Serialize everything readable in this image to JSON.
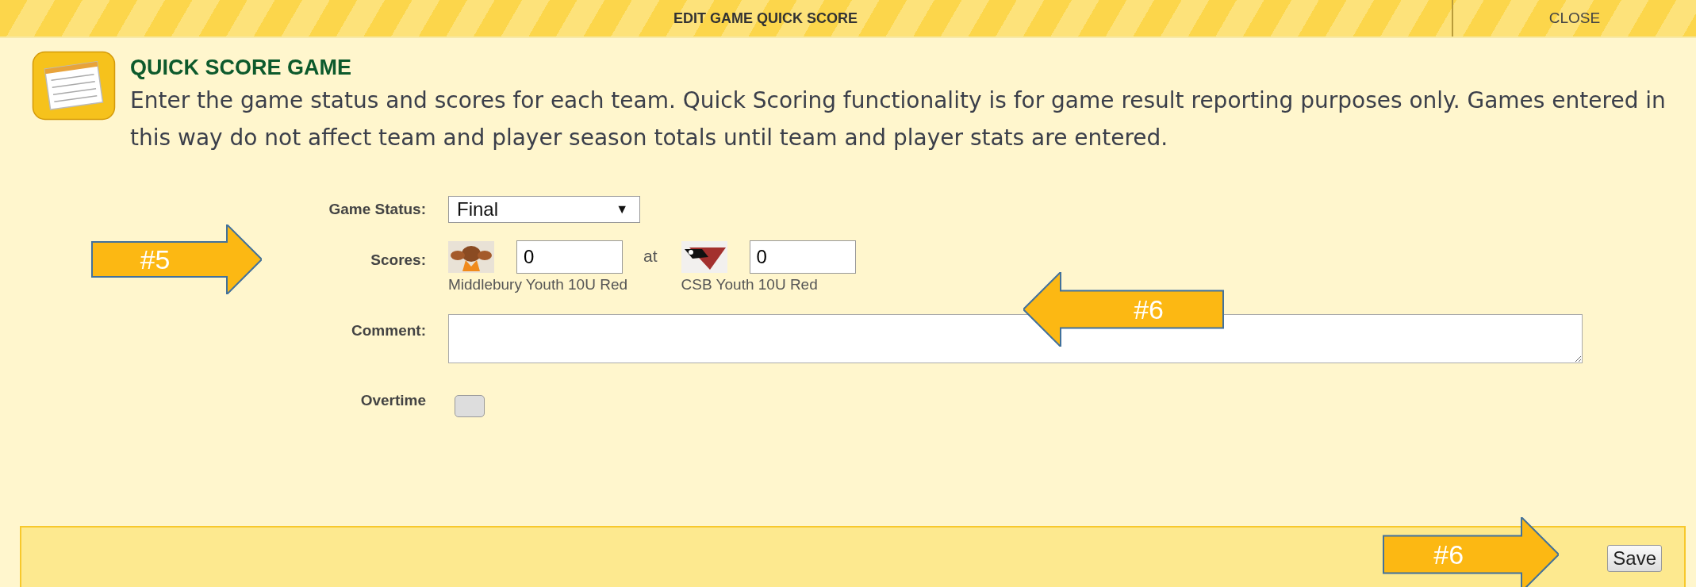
{
  "dialog": {
    "title": "EDIT GAME QUICK SCORE",
    "close": "CLOSE"
  },
  "heading": "QUICK SCORE GAME",
  "description": "Enter the game status and scores for each team. Quick Scoring functionality is for game result reporting purposes only. Games entered in this way do not affect team and player season totals until team and player stats are entered.",
  "form": {
    "status": {
      "label": "Game Status:",
      "value": "Final",
      "caret": "▼"
    },
    "scores": {
      "label": "Scores:",
      "separator": "at",
      "teams": [
        {
          "name": "Middlebury Youth 10U Red",
          "score": "0"
        },
        {
          "name": "CSB Youth 10U Red",
          "score": "0"
        }
      ]
    },
    "comment": {
      "label": "Comment:"
    },
    "overtime": {
      "label": "Overtime",
      "checked": false
    }
  },
  "footer": {
    "button": "Save"
  },
  "callouts": [
    {
      "label": "#5",
      "kind": "right"
    },
    {
      "label": "#6",
      "kind": "left"
    },
    {
      "label": "#6",
      "kind": "right"
    }
  ]
}
